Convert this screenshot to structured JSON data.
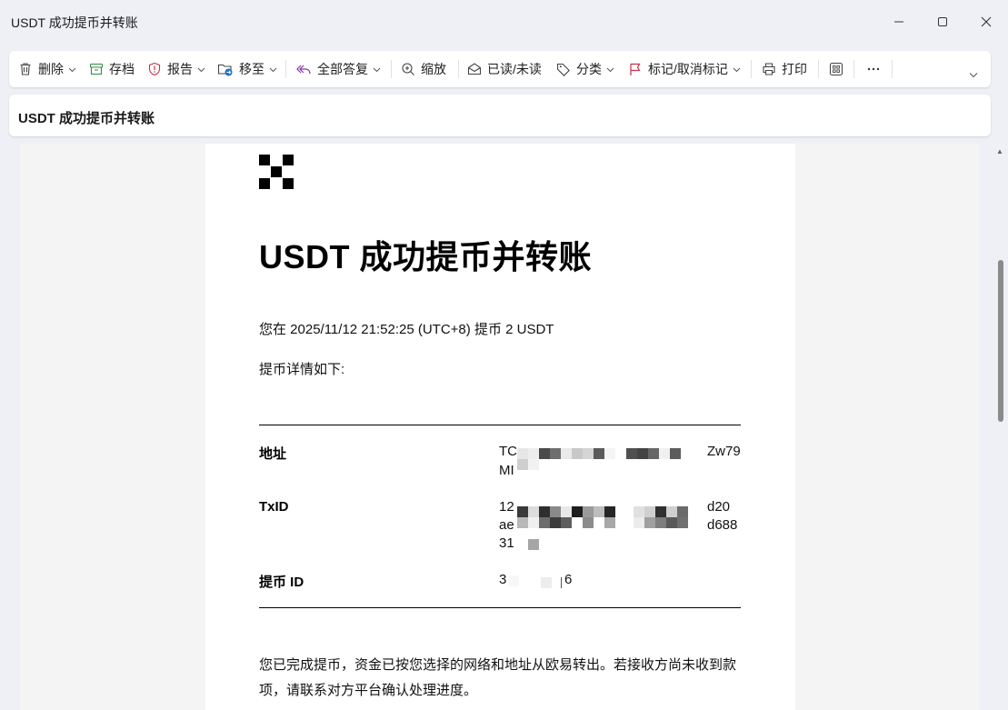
{
  "window": {
    "title": "USDT 成功提币并转账"
  },
  "toolbar": {
    "delete": "删除",
    "archive": "存档",
    "report": "报告",
    "move": "移至",
    "reply_all": "全部答复",
    "zoom": "缩放",
    "read_unread": "已读/未读",
    "categorize": "分类",
    "flag": "标记/取消标记",
    "print": "打印"
  },
  "message": {
    "subject": "USDT 成功提币并转账",
    "headline": "USDT 成功提币并转账",
    "intro": "您在 2025/11/12 21:52:25 (UTC+8) 提币 2 USDT",
    "details_label": "提币详情如下:",
    "rows": [
      {
        "label": "地址",
        "lines": [
          "TC",
          "Zw79",
          "MI"
        ]
      },
      {
        "label": "TxID",
        "lines": [
          "12",
          "d20",
          "ae",
          "d688",
          "31"
        ]
      },
      {
        "label": "提币 ID",
        "lines": [
          "3",
          "6"
        ]
      }
    ],
    "footer": "您已完成提币，资金已按您选择的网络和地址从欧易转出。若接收方尚未收到款项，请联系对方平台确认处理进度。"
  },
  "colors": {
    "accent_blue": "#1a73c8",
    "archive_green": "#2e8a3e",
    "report_red": "#c4314b",
    "reply_purple": "#8a3aa6",
    "flag_red": "#c4314b"
  }
}
